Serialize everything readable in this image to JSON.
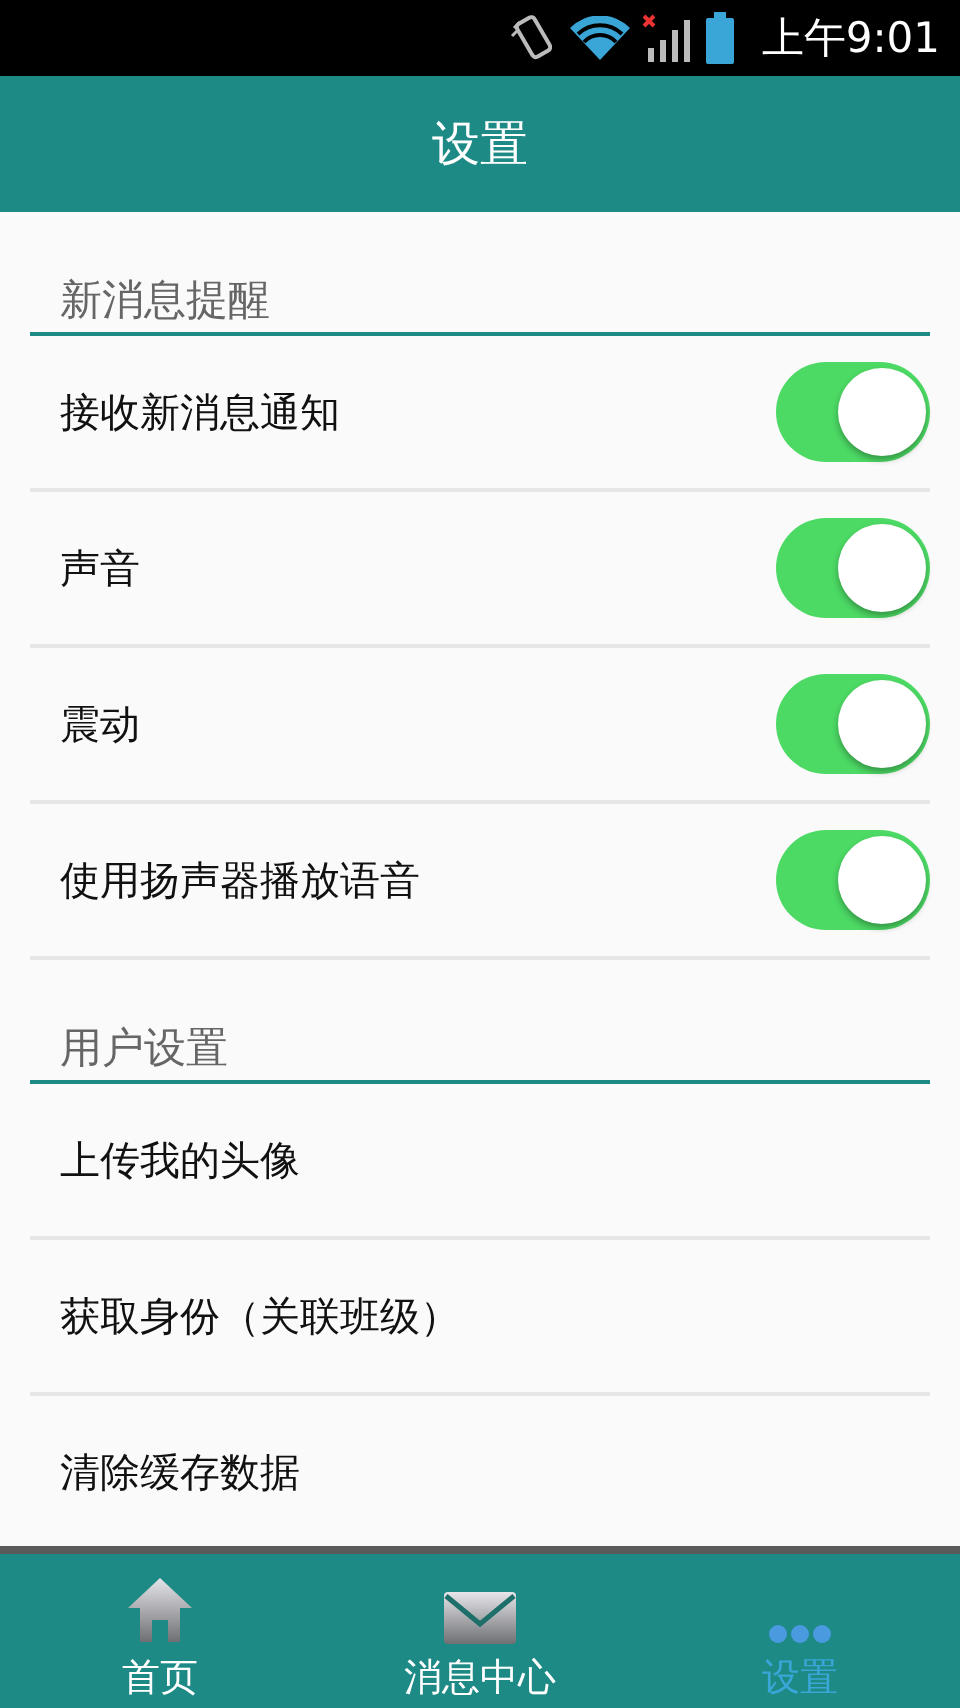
{
  "status_bar": {
    "time": "上午9:01"
  },
  "header": {
    "title": "设置"
  },
  "sections": [
    {
      "title": "新消息提醒",
      "items": [
        {
          "kind": "toggle",
          "label": "接收新消息通知",
          "on": true
        },
        {
          "kind": "toggle",
          "label": "声音",
          "on": true
        },
        {
          "kind": "toggle",
          "label": "震动",
          "on": true
        },
        {
          "kind": "toggle",
          "label": "使用扬声器播放语音",
          "on": true
        }
      ]
    },
    {
      "title": "用户设置",
      "items": [
        {
          "kind": "plain",
          "label": "上传我的头像"
        },
        {
          "kind": "plain",
          "label": "获取身份（关联班级）"
        },
        {
          "kind": "plain",
          "label": "清除缓存数据"
        }
      ]
    }
  ],
  "nav": [
    {
      "kind": "home",
      "label": "首页",
      "selected": false
    },
    {
      "kind": "mail",
      "label": "消息中心",
      "selected": false
    },
    {
      "kind": "more",
      "label": "设置",
      "selected": true
    }
  ]
}
